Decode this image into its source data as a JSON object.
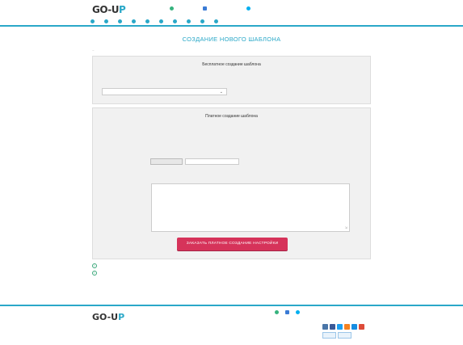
{
  "header": {
    "logo_text": "GO-UP",
    "phone": "",
    "email": "",
    "skype": "",
    "note_line1": "",
    "note_line2": ""
  },
  "nav": {
    "items": [
      {
        "label": "",
        "icon": "home-icon"
      },
      {
        "label": "",
        "icon": "wallet-icon"
      },
      {
        "label": "",
        "icon": "user-icon"
      },
      {
        "label": "",
        "icon": "panel-icon"
      },
      {
        "label": "",
        "icon": "template-icon"
      },
      {
        "label": "",
        "icon": "blog-icon"
      },
      {
        "label": "",
        "icon": "tickets-icon"
      },
      {
        "label": "",
        "icon": "news-icon"
      },
      {
        "label": "",
        "icon": "faq-icon"
      },
      {
        "label": "",
        "icon": "logout-icon"
      }
    ]
  },
  "page": {
    "title": "СОЗДАНИЕ НОВОГО ШАБЛОНА",
    "back_link": ""
  },
  "free_panel": {
    "title": "Бесплатное создание шаблона",
    "text_line1": "",
    "text_line2": "",
    "select_value": ""
  },
  "paid_panel": {
    "title": "Платное создание шаблона",
    "text_line1": "",
    "text_line2": "",
    "text_line3": "",
    "link1": "",
    "link2": "",
    "attach_label": "",
    "file_button": "",
    "file_placeholder": "",
    "add_more": "",
    "formats_line1": "",
    "formats_line2": "",
    "extra_label_line1": "",
    "extra_label_line2": "",
    "extra_placeholder": "",
    "order_button": "ЗАКАЗАТЬ ПЛАТНОЕ СОЗДАНИЕ НАСТРОЙКИ"
  },
  "notes": [
    {
      "text": "",
      "icon": "info-icon"
    },
    {
      "text": "",
      "icon": "info-icon"
    }
  ],
  "bottom_link": "",
  "footer": {
    "logo_text": "GO-UP",
    "logo_subtitle": "",
    "copyright_line1": "",
    "copyright_line2": "",
    "col1": [
      "",
      "",
      ""
    ],
    "col2": [
      "",
      "",
      ""
    ],
    "col3": [
      "",
      "",
      ""
    ],
    "phone": "",
    "email": "",
    "skype": "",
    "disclaimer": ""
  },
  "colors": {
    "accent": "#2aa8c8",
    "button": "#d6335a",
    "link": "#2a73a8"
  }
}
